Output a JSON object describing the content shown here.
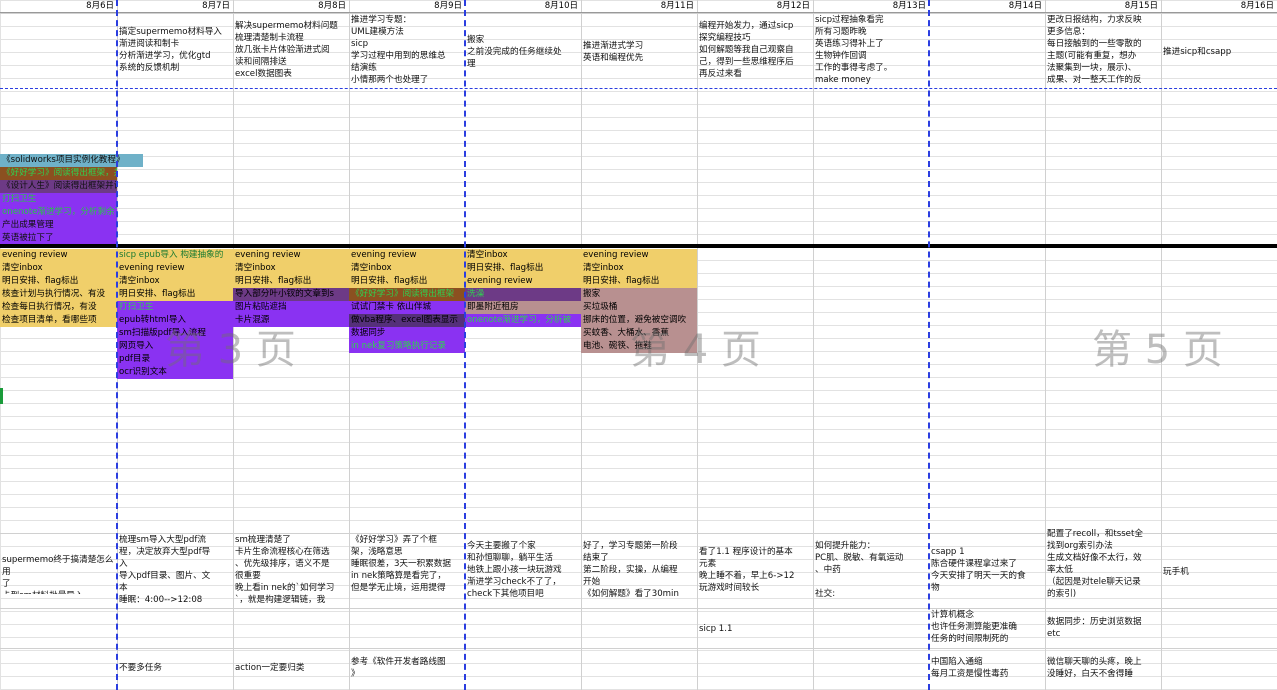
{
  "colors": {
    "header_bg": "#ffffff",
    "gold": "#f0cf6a",
    "purple": "#8a32f2",
    "dark_purple": "#6b25b8",
    "violet_dark": "#55307a",
    "rose": "#b89090",
    "teal": "#6fb1c8",
    "brown": "#8b5020",
    "olive": "#6d3a86",
    "green_text": "#1aa33a",
    "blue_text": "#2238c8",
    "page_break": "#2b3ee0"
  },
  "dates": [
    "8月6日",
    "8月7日",
    "8月8日",
    "8月9日",
    "8月10日",
    "8月11日",
    "8月12日",
    "8月13日",
    "8月14日",
    "8月15日",
    "8月16日"
  ],
  "top_notes": [
    "",
    "搞定supermemo材料导入\n渐进阅读和制卡\n分析渐进学习，优化gtd\n系统的反馈机制",
    "解决supermemo材料问题\n梳理清楚制卡流程\n放几张卡片体验渐进式阅\n读和间隔排送\nexcel数据图表",
    "推进学习专题：\nUML建模方法\nsicp\n学习过程中用到的思维总\n结演练\n小情那两个也处理了",
    "搬家\n之前没完成的任务继续处\n理",
    "推进渐进式学习\n英语和编程优先",
    "编程开始发力，通过sicp\n探究编程技巧\n如何解题等我自己观察自\n己，得到一些思维程序后\n再反过来看",
    "sicp过程抽象看完\n所有习题昨晚\n英语练习得补上了\n生物钟作回调\n工作的事得考虑了。\nmake money",
    "",
    "更改日报结构，力求反映\n更多信息：\n每日接触到的一些零散的\n主题(可能有重复，想办\n法聚集到一块，展示)、\n成果、对一整天工作的反",
    "推进sicp和csapp"
  ],
  "block_a": [
    "《solidworks项目实例化教程》",
    "《好好学习》阅读得出框架，并准备提问",
    "《设计人生》阅读得出框架并设计实践",
    "打扫卫生",
    "onenote渐进学习，分析剩余下的原因",
    "产出成果管理",
    "英语被拉下了"
  ],
  "col1_tasks": [
    "evening review",
    "清空inbox",
    "明日安排、flag标出",
    "核查计划与执行情况、有没",
    "检查每日执行情况，有没",
    "检查项目清单，看哪些项"
  ],
  "col2_tasks": [
    "sicp epub导入 构建抽象的",
    "evening review",
    "清空inbox",
    "明日安排、flag标出",
    "打扫卫生",
    "epub转html导入",
    "sm扫描版pdf导入流程",
    "网页导入",
    "pdf目录",
    "ocr识别文本"
  ],
  "col3_tasks": [
    "evening review",
    "清空inbox",
    "明日安排、flag标出",
    "导入部分叶小钗的文章到s",
    "图片粘贴遮挡",
    "卡片混源"
  ],
  "col4_tasks": [
    "evening review",
    "清空inbox",
    "明日安排、flag标出",
    "《好好学习》阅读得出框架",
    "试试门禁卡 依山伴城",
    "做vba程序、excel图表显示",
    "数据同步",
    "in nek复习策略执行记录"
  ],
  "col5_tasks": [
    "清空inbox",
    "明日安排、flag标出",
    "evening review",
    "洗澡",
    "即墨附近租房",
    "onenote渐进学习，分析被"
  ],
  "col6_tasks": [
    "evening review",
    "清空inbox",
    "明日安排、flag标出",
    "搬家",
    "买垃圾桶",
    "挪床的位置，避免被空调吹",
    "买蚊香、大桶水、香蕉",
    "电池、碗筷、拖鞋"
  ],
  "watermarks": [
    "第 3 页",
    "第 4 页",
    "第 5 页"
  ],
  "bottom_notes": [
    "supermemo终于搞清楚怎么用\n了\n卡到sm材料批量导入",
    "梳理sm导入大型pdf流\n程，决定放弃大型pdf导\n入\n导入pdf目录、图片、文\n本\n睡眠：4:00-->12:08",
    "sm梳理清楚了\n卡片生命流程核心在筛选\n、优先级排序，语义不是\n很重要\n晚上看in nek的`如何学习\n`，就是构建逻辑链，我",
    "《好好学习》弄了个框\n架，浅略意思\n睡眠很差，3天一积累数据\nin nek策略算是看完了，\n但是学无止境，运用提得",
    "今天主要搬了个家\n和孙恒聊聊，躺平生活\n地铁上跟小孩一块玩游戏\n渐进学习check不了了，\ncheck下其他项目吧",
    "好了，学习专题第一阶段\n结束了\n第二阶段，实操，从编程\n开始\n《如何解题》看了30min",
    "看了1.1 程序设计的基本\n元素\n晚上睡不着，早上6->12\n玩游戏时间较长",
    "如何提升能力：\nPC肌、脱敏、有氧运动\n、中药\n\n社交:",
    "csapp 1\n陈合硬件课程拿过来了\n今天安排了明天一天的食\n物",
    "配置了recoll，和tsset全\n找到org索引办法\n生成文档好像不太行，效\n率太低\n（起因是对tele聊天记录\n的索引)",
    "玩手机"
  ],
  "row_b": [
    "",
    "",
    "",
    "",
    "",
    "",
    "sicp 1.1",
    "",
    "计算机概念\n也许任务测算能更准确\n任务的时间限制死的",
    "数据同步：历史浏览数据\netc",
    ""
  ],
  "row_c": [
    "",
    "不要多任务",
    "action一定要归类",
    "参考《软件开发者路线图\n》",
    "",
    "",
    "",
    "",
    "中国陷入通缩\n每月工资是慢性毒药",
    "微信聊天聊的头疼，晚上\n没睡好，白天不舍得睡",
    ""
  ]
}
